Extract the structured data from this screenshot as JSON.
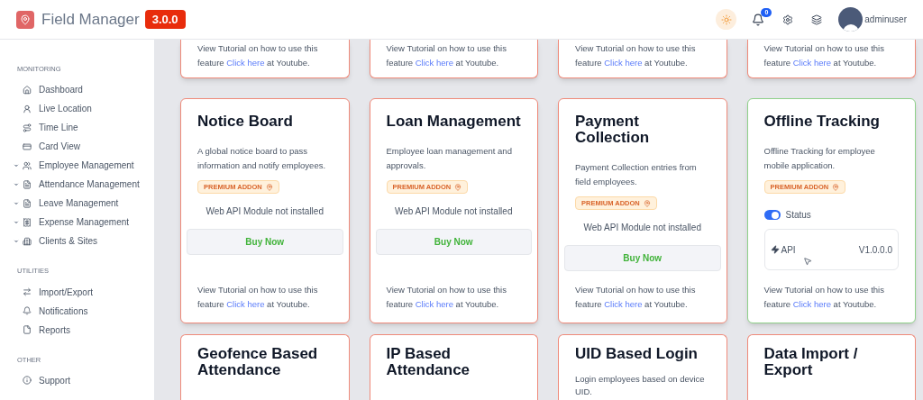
{
  "header": {
    "app_name": "Field Manager",
    "version": "3.0.0",
    "notification_count": "0",
    "username": "adminuser"
  },
  "sidebar": {
    "sections": [
      {
        "title": "MONITORING",
        "items": [
          {
            "label": "Dashboard",
            "expandable": false
          },
          {
            "label": "Live Location",
            "expandable": false
          },
          {
            "label": "Time Line",
            "expandable": false
          },
          {
            "label": "Card View",
            "expandable": false
          },
          {
            "label": "Employee Management",
            "expandable": true
          },
          {
            "label": "Attendance Management",
            "expandable": true
          },
          {
            "label": "Leave Management",
            "expandable": true
          },
          {
            "label": "Expense Management",
            "expandable": true
          },
          {
            "label": "Clients & Sites",
            "expandable": true
          }
        ]
      },
      {
        "title": "UTILITIES",
        "items": [
          {
            "label": "Import/Export",
            "expandable": false
          },
          {
            "label": "Notifications",
            "expandable": false
          },
          {
            "label": "Reports",
            "expandable": false
          }
        ]
      },
      {
        "title": "OTHER",
        "items": [
          {
            "label": "Support",
            "expandable": false
          }
        ]
      }
    ]
  },
  "top_cards": [
    {
      "tutorial": {
        "before": "View Tutorial on how to use this feature",
        "link": "Click here",
        "after": "at Youtube."
      }
    },
    {
      "tutorial": {
        "before": "View Tutorial on how to use this feature",
        "link": "Click here",
        "after": "at Youtube."
      }
    },
    {
      "tutorial": {
        "before": "View Tutorial on how to use this feature",
        "link": "Click here",
        "after": "at Youtube."
      }
    },
    {
      "tutorial": {
        "before": "View Tutorial on how to use this feature",
        "link": "Click here",
        "after": "at Youtube."
      }
    }
  ],
  "cards": [
    {
      "title": "Notice Board",
      "description": "A global notice board to pass information and notify employees.",
      "badge": "PREMIUM ADDON",
      "installed": false,
      "message": "Web API Module not installed",
      "button": "Buy Now",
      "tutorial": {
        "before": "View Tutorial on how to use this feature",
        "link": "Click here",
        "after": "at Youtube."
      }
    },
    {
      "title": "Loan Management",
      "description": "Employee loan management and approvals.",
      "badge": "PREMIUM ADDON",
      "installed": false,
      "message": "Web API Module not installed",
      "button": "Buy Now",
      "tutorial": {
        "before": "View Tutorial on how to use this feature",
        "link": "Click here",
        "after": "at Youtube."
      }
    },
    {
      "title": "Payment Collection",
      "description": "Payment Collection entries from field employees.",
      "badge": "PREMIUM ADDON",
      "installed": false,
      "message": "Web API Module not installed",
      "button": "Buy Now",
      "tutorial": {
        "before": "View Tutorial on how to use this feature",
        "link": "Click here",
        "after": "at Youtube."
      }
    },
    {
      "title": "Offline Tracking",
      "description": "Offline Tracking for employee mobile application.",
      "badge": "PREMIUM ADDON",
      "installed": true,
      "status": {
        "label": "Status",
        "on": true
      },
      "api": {
        "label": "API",
        "version": "V1.0.0.0"
      },
      "tutorial": {
        "before": "View Tutorial on how to use this feature",
        "link": "Click here",
        "after": "at Youtube."
      }
    }
  ],
  "bottom_cards": [
    {
      "title": "Geofence Based Attendance"
    },
    {
      "title": "IP Based Attendance"
    },
    {
      "title": "UID Based Login",
      "description": "Login employees based on device UID."
    },
    {
      "title": "Data Import / Export"
    }
  ]
}
